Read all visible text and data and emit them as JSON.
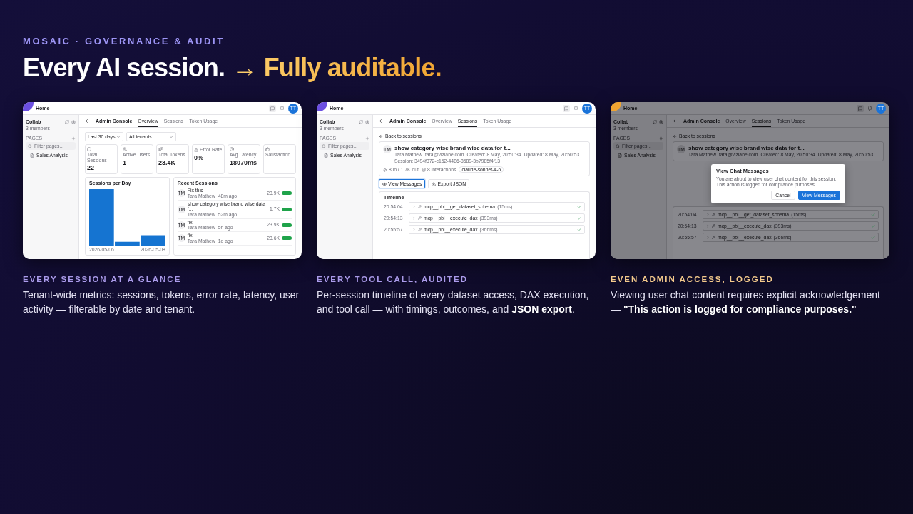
{
  "eyebrow": "MOSAIC · GOVERNANCE & AUDIT",
  "headline": {
    "lead": "Every AI session.",
    "accent": "→ Fully auditable."
  },
  "panels": [
    {
      "color": "#6b4fe0",
      "caption_title": "EVERY SESSION AT A GLANCE",
      "caption_text": "Tenant-wide metrics: sessions, tokens, error rate, latency, user activity — filterable by date and tenant.",
      "screen": {
        "dimmed": false,
        "home": "Home",
        "avatar": "TT",
        "workspace": "Collab",
        "members": "3 members",
        "pages_label": "PAGES",
        "filter_placeholder": "Filter pages...",
        "pages": [
          "Sales Analysis"
        ],
        "console_title": "Admin Console",
        "tabs": [
          {
            "label": "Overview",
            "selected": true
          },
          {
            "label": "Sessions",
            "selected": false
          },
          {
            "label": "Token Usage",
            "selected": false
          }
        ],
        "content": {
          "kind": "overview",
          "filters": [
            "Last 30 days",
            "All tenants"
          ],
          "metrics": [
            {
              "label": "Total Sessions",
              "value": "22"
            },
            {
              "label": "Active Users",
              "value": "1"
            },
            {
              "label": "Total Tokens",
              "value": "23.4K"
            },
            {
              "label": "Error Rate",
              "value": "0%"
            },
            {
              "label": "Avg Latency",
              "value": "18070ms"
            },
            {
              "label": "Satisfaction",
              "value": "—"
            }
          ],
          "chart_title": "Sessions per Day",
          "chart_start": "2026-05-06",
          "chart_end": "2026-05-08",
          "recent_title": "Recent Sessions",
          "recent": [
            {
              "avatar": "TM",
              "title": "Fix this",
              "user": "Tara Mathew",
              "time": "48m ago",
              "tokens": "23.9K"
            },
            {
              "avatar": "TM",
              "title": "show category wise brand wise data f...",
              "user": "Tara Mathew",
              "time": "52m ago",
              "tokens": "1.7K"
            },
            {
              "avatar": "TM",
              "title": "fix",
              "user": "Tara Mathew",
              "time": "5h ago",
              "tokens": "23.9K"
            },
            {
              "avatar": "TM",
              "title": "fix",
              "user": "Tara Mathew",
              "time": "1d ago",
              "tokens": "23.6K"
            }
          ]
        }
      }
    },
    {
      "color": "#6b4fe0",
      "caption_title": "EVERY TOOL CALL, AUDITED",
      "caption_text": "Per-session timeline of every dataset access, DAX execution, and tool call — with timings, outcomes, and **JSON export**.",
      "screen": {
        "dimmed": false,
        "home": "Home",
        "avatar": "TT",
        "workspace": "Collab",
        "members": "3 members",
        "pages_label": "PAGES",
        "filter_placeholder": "Filter pages...",
        "pages": [
          "Sales Analysis"
        ],
        "console_title": "Admin Console",
        "tabs": [
          {
            "label": "Overview",
            "selected": false
          },
          {
            "label": "Sessions",
            "selected": true
          },
          {
            "label": "Token Usage",
            "selected": false
          }
        ],
        "content": {
          "kind": "session",
          "back": "Back to sessions",
          "avatar": "TM",
          "title": "show category wise brand wise data for t...",
          "meta": [
            "Tara Mathew",
            "tara@vizlabe.com",
            "Created: 8 May, 20:50:34",
            "Updated: 8 May, 20:50:53"
          ],
          "session_id": "Session: 3494f372-c152-4486-8589-3b7985f4f13",
          "stats": [
            "8 in / 1.7K out",
            "8 interactions"
          ],
          "model": "claude-sonnet-4-6",
          "actions": [
            {
              "kind": "view",
              "label": "View Messages",
              "focused": true
            },
            {
              "kind": "export",
              "label": "Export JSON",
              "focused": false
            }
          ],
          "timeline_title": "Timeline",
          "timeline": [
            {
              "time": "20:54:04",
              "name": "mcp__pbi__get_dataset_schema",
              "duration": "(15ms)"
            },
            {
              "time": "20:54:13",
              "name": "mcp__pbi__execute_dax",
              "duration": "(393ms)"
            },
            {
              "time": "20:55:57",
              "name": "mcp__pbi__execute_dax",
              "duration": "(366ms)"
            }
          ]
        }
      }
    },
    {
      "color": "#f0a431",
      "caption_title": "EVEN ADMIN ACCESS, LOGGED",
      "caption_text": "Viewing user chat content requires explicit acknowledgement — **\"This action is logged for compliance purposes.\"**",
      "screen": {
        "dimmed": true,
        "home": "Home",
        "avatar": "TT",
        "workspace": "Collab",
        "members": "3 members",
        "pages_label": "PAGES",
        "filter_placeholder": "Filter pages...",
        "pages": [
          "Sales Analysis"
        ],
        "console_title": "Admin Console",
        "tabs": [
          {
            "label": "Overview",
            "selected": false
          },
          {
            "label": "Sessions",
            "selected": true
          },
          {
            "label": "Token Usage",
            "selected": false
          }
        ],
        "content": {
          "kind": "session",
          "back": "Back to sessions",
          "avatar": "TM",
          "title": "show category wise brand wise data for t...",
          "meta": [
            "Tara Mathew",
            "tara@vizlabe.com",
            "Created: 8 May, 20:50:34",
            "Updated: 8 May, 20:50:53"
          ],
          "timeline": [
            {
              "time": "20:54:04",
              "name": "mcp__pbi__get_dataset_schema",
              "duration": "(15ms)"
            },
            {
              "time": "20:54:13",
              "name": "mcp__pbi__execute_dax",
              "duration": "(393ms)"
            },
            {
              "time": "20:55:57",
              "name": "mcp__pbi__execute_dax",
              "duration": "(366ms)"
            }
          ],
          "modal": {
            "title": "View Chat Messages",
            "body": "You are about to view user chat content for this session. This action is logged for compliance purposes.",
            "cancel": "Cancel",
            "confirm": "View Messages"
          }
        }
      }
    }
  ]
}
